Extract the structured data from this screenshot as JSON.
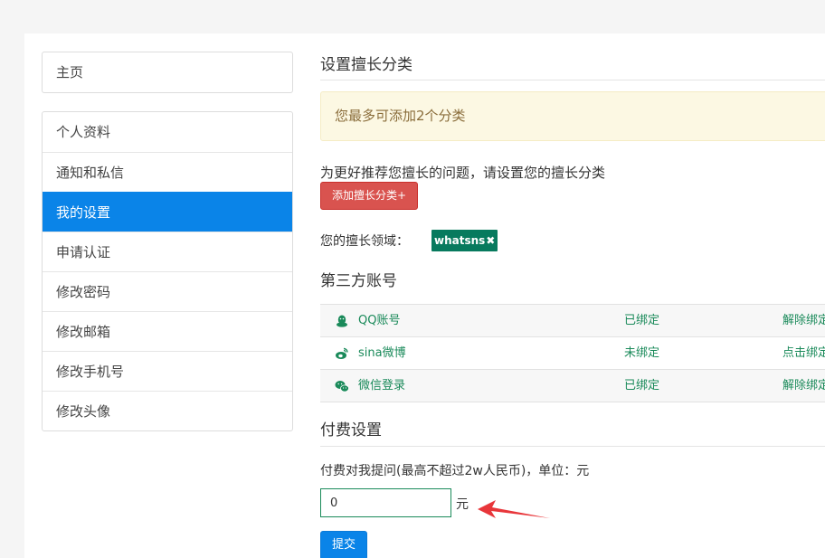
{
  "sidebar": {
    "home": "主页",
    "items": [
      {
        "label": "个人资料",
        "active": false
      },
      {
        "label": "通知和私信",
        "active": false
      },
      {
        "label": "我的设置",
        "active": true
      },
      {
        "label": "申请认证",
        "active": false
      },
      {
        "label": "修改密码",
        "active": false
      },
      {
        "label": "修改邮箱",
        "active": false
      },
      {
        "label": "修改手机号",
        "active": false
      },
      {
        "label": "修改头像",
        "active": false
      }
    ]
  },
  "expertise": {
    "title": "设置擅长分类",
    "alert": "您最多可添加2个分类",
    "hint": "为更好推荐您擅长的问题，请设置您的擅长分类",
    "add_button": "添加擅长分类+",
    "field_label": "您的擅长领域：",
    "tags": [
      {
        "label": "whatsns",
        "remove_icon": "✖"
      }
    ]
  },
  "third_party": {
    "title": "第三方账号",
    "rows": [
      {
        "icon": "qq-icon",
        "name": "QQ账号",
        "status": "已绑定",
        "action": "解除绑定"
      },
      {
        "icon": "weibo-icon",
        "name": "sina微博",
        "status": "未绑定",
        "action": "点击绑定"
      },
      {
        "icon": "wechat-icon",
        "name": "微信登录",
        "status": "已绑定",
        "action": "解除绑定"
      }
    ]
  },
  "payment": {
    "title": "付费设置",
    "label": "付费对我提问(最高不超过2w人民币)，单位：元",
    "input_value": "0",
    "unit": "元",
    "submit": "提交"
  },
  "colors": {
    "primary": "#0a84e8",
    "danger": "#d9534f",
    "tag": "#077a5e",
    "link_green": "#1a8a5a",
    "arrow": "#e8363a"
  }
}
